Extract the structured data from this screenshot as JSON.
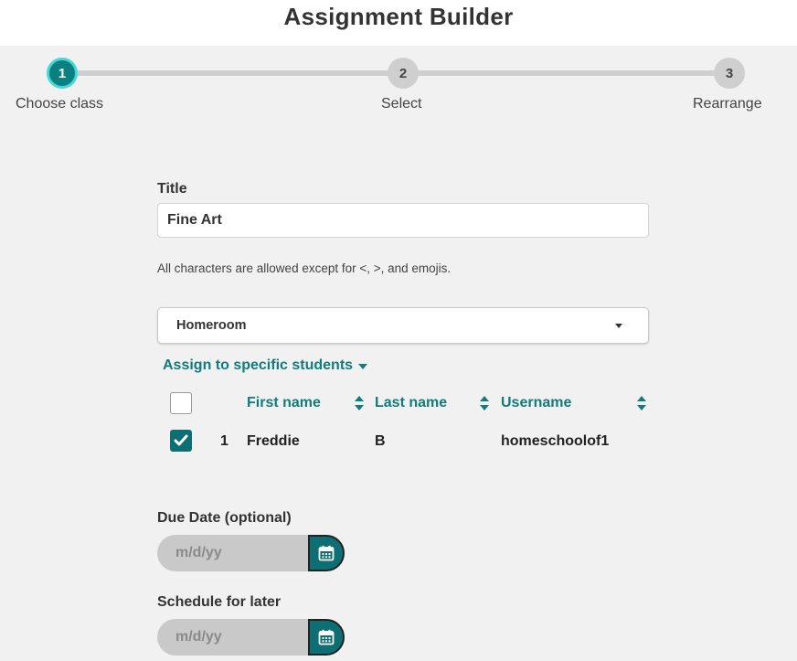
{
  "header": {
    "title": "Assignment Builder"
  },
  "stepper": {
    "steps": [
      {
        "number": "1",
        "label": "Choose class",
        "active": true
      },
      {
        "number": "2",
        "label": "Select",
        "active": false
      },
      {
        "number": "3",
        "label": "Rearrange",
        "active": false
      }
    ]
  },
  "form": {
    "title_label": "Title",
    "title_value": "Fine Art",
    "title_hint": "All characters are allowed except for <, >, and emojis.",
    "class_select_value": "Homeroom",
    "assign_link": "Assign to specific students"
  },
  "students_table": {
    "columns": [
      "First name",
      "Last name",
      "Username"
    ],
    "rows": [
      {
        "index": "1",
        "first_name": "Freddie",
        "last_name": "B",
        "username": "homeschoolof1",
        "checked": true
      }
    ],
    "select_all_checked": false
  },
  "due_date": {
    "label": "Due Date (optional)",
    "placeholder": "m/d/yy"
  },
  "schedule": {
    "label": "Schedule for later",
    "placeholder": "m/d/yy"
  },
  "colors": {
    "accent": "#0d6e73",
    "link": "#127b7b",
    "active_step_ring": "#49d6d6"
  },
  "icons": {
    "sort": "sort-arrows-icon",
    "calendar": "calendar-icon",
    "checkmark": "checkmark-icon",
    "dropdown": "chevron-down-icon"
  }
}
